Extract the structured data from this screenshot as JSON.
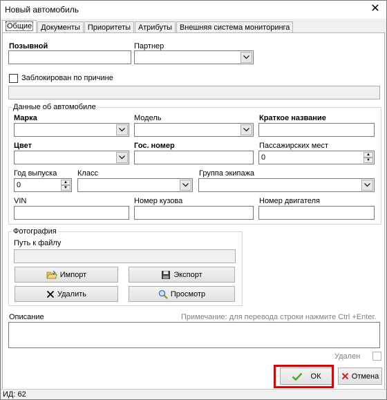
{
  "window": {
    "title": "Новый автомобиль",
    "close": "✕"
  },
  "tabs": [
    {
      "label": "Общие",
      "active": true
    },
    {
      "label": "Документы"
    },
    {
      "label": "Приоритеты"
    },
    {
      "label": "Атрибуты"
    },
    {
      "label": "Внешняя система мониторинга"
    }
  ],
  "form": {
    "callsign_label": "Позывной",
    "partner_label": "Партнер",
    "blocked_label": "Заблокирован по причине",
    "car_group_title": "Данные об автомобиле",
    "brand_label": "Марка",
    "model_label": "Модель",
    "short_name_label": "Краткое название",
    "color_label": "Цвет",
    "plate_label": "Гос. номер",
    "seats_label": "Пассажирских мест",
    "seats_value": "0",
    "year_label": "Год выпуска",
    "year_value": "0",
    "class_label": "Класс",
    "crew_group_label": "Группа экипажа",
    "vin_label": "VIN",
    "body_label": "Номер кузова",
    "engine_label": "Номер двигателя",
    "photo_title": "Фотография",
    "path_label": "Путь к файлу",
    "import_label": "Импорт",
    "export_label": "Экспорт",
    "delete_label": "Удалить",
    "view_label": "Просмотр",
    "description_label": "Описание",
    "description_note": "Примечание: для перевода строки нажмите Ctrl +Enter.",
    "deleted_label": "Удален"
  },
  "buttons": {
    "ok": "ОК",
    "cancel": "Отмена"
  },
  "status": {
    "id_text": "ИД: 62"
  },
  "colors": {
    "highlight": "#e00000",
    "ok_check": "#4caf1e",
    "cancel_x": "#d22020"
  }
}
